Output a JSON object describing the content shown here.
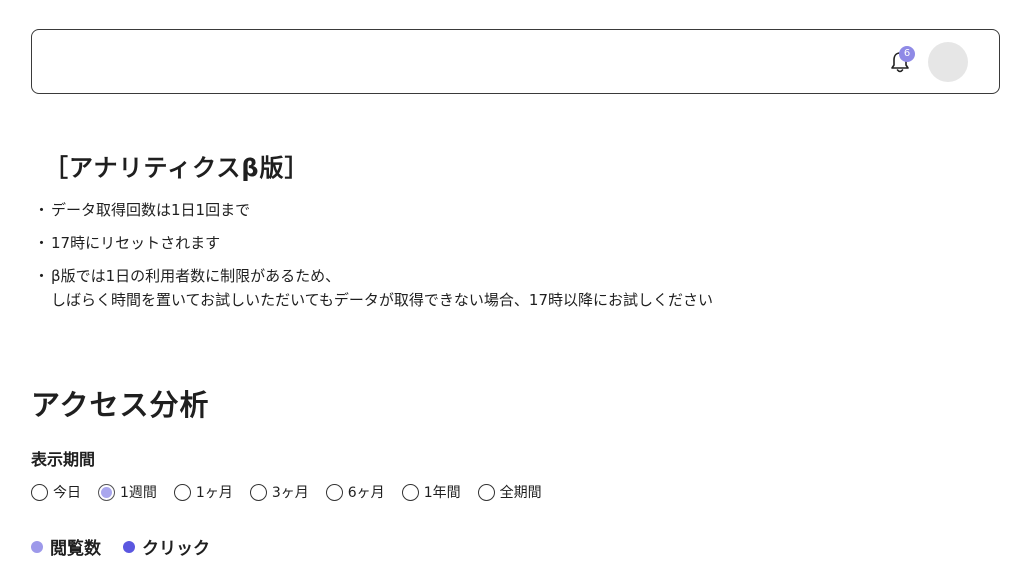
{
  "header": {
    "notification_count": "6",
    "colors": {
      "badge": "#8f8ae6",
      "avatar": "#e6e6e6"
    }
  },
  "notice": {
    "title": "［アナリティクスβ版］",
    "items": [
      {
        "bullet": "・",
        "text": "データ取得回数は1日1回まで"
      },
      {
        "bullet": "・",
        "text": "17時にリセットされます"
      },
      {
        "bullet": "・",
        "text": "β版では1日の利用者数に制限があるため、\nしばらく時間を置いてお試しいただいてもデータが取得できない場合、17時以降にお試しください"
      }
    ]
  },
  "analytics": {
    "title": "アクセス分析",
    "period_label": "表示期間",
    "periods": [
      {
        "label": "今日",
        "selected": false
      },
      {
        "label": "1週間",
        "selected": true
      },
      {
        "label": "1ヶ月",
        "selected": false
      },
      {
        "label": "3ヶ月",
        "selected": false
      },
      {
        "label": "6ヶ月",
        "selected": false
      },
      {
        "label": "1年間",
        "selected": false
      },
      {
        "label": "全期間",
        "selected": false
      }
    ],
    "legend": [
      {
        "label": "閲覧数",
        "color": "#9d99ea"
      },
      {
        "label": "クリック",
        "color": "#5b57e0"
      }
    ]
  }
}
